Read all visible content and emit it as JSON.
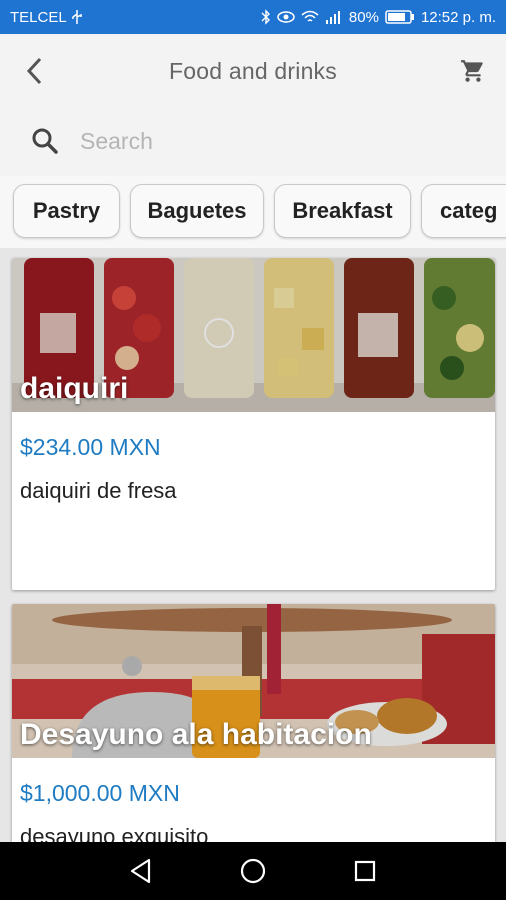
{
  "status_bar": {
    "carrier": "TELCEL",
    "battery": "80%",
    "time": "12:52 p. m."
  },
  "header": {
    "title": "Food and drinks",
    "back_icon": "back-arrow-icon",
    "cart_icon": "shopping-cart-icon"
  },
  "search": {
    "placeholder": "Search",
    "value": ""
  },
  "categories": [
    "Pastry",
    "Baguetes",
    "Breakfast",
    "categ"
  ],
  "products": [
    {
      "title": "daiquiri",
      "price": "$234.00 MXN",
      "description": "daiquiri de fresa"
    },
    {
      "title": "Desayuno ala habitacion",
      "price": "$1,000.00 MXN",
      "description": "desayuno exquisito"
    }
  ],
  "colors": {
    "status_bar": "#1f73d1",
    "price": "#1f7bc2",
    "app_bar": "#f3f3f3"
  }
}
